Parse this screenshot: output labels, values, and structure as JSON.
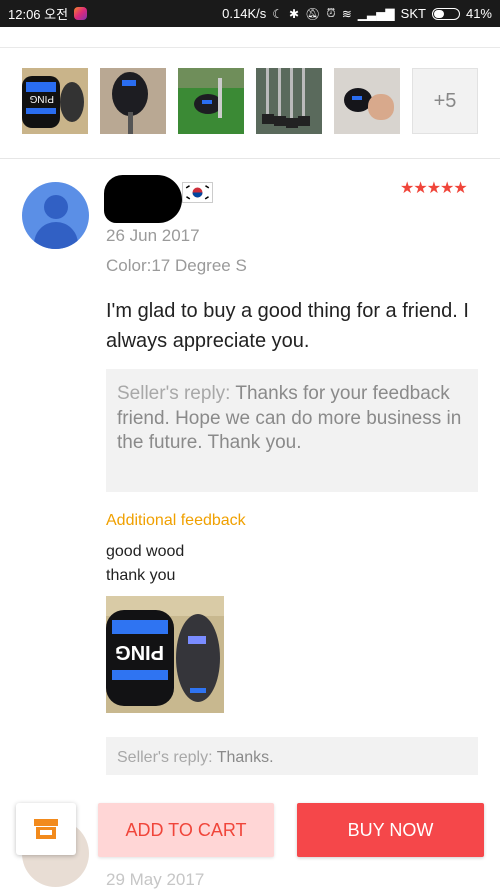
{
  "status_bar": {
    "time": "12:06 오전",
    "speed": "0.14K/s",
    "carrier": "SKT",
    "battery": "41%",
    "battery_level": 0.41
  },
  "thumbnails": {
    "more_label": "+5"
  },
  "review": {
    "rating_stars": "★★★★★",
    "rating": 5,
    "date": "26 Jun 2017",
    "color": "Color:17 Degree S",
    "text": "I'm glad to buy a good thing for a friend. I always appreciate you.",
    "seller_reply_label": "Seller's reply:",
    "seller_reply_text": " Thanks for your feedback friend. Hope we can do more business in the future. Thank you.",
    "additional_title": "Additional feedback",
    "additional_line1": "good wood",
    "additional_line2": "thank you",
    "seller_reply2_label": "Seller's reply:",
    "seller_reply2_text": " Thanks."
  },
  "next_review": {
    "date": "29 May 2017"
  },
  "actions": {
    "add_to_cart": "ADD TO CART",
    "buy_now": "BUY NOW"
  },
  "colors": {
    "accent": "#f5474a",
    "star": "#f0453a",
    "additional": "#f0a000"
  }
}
